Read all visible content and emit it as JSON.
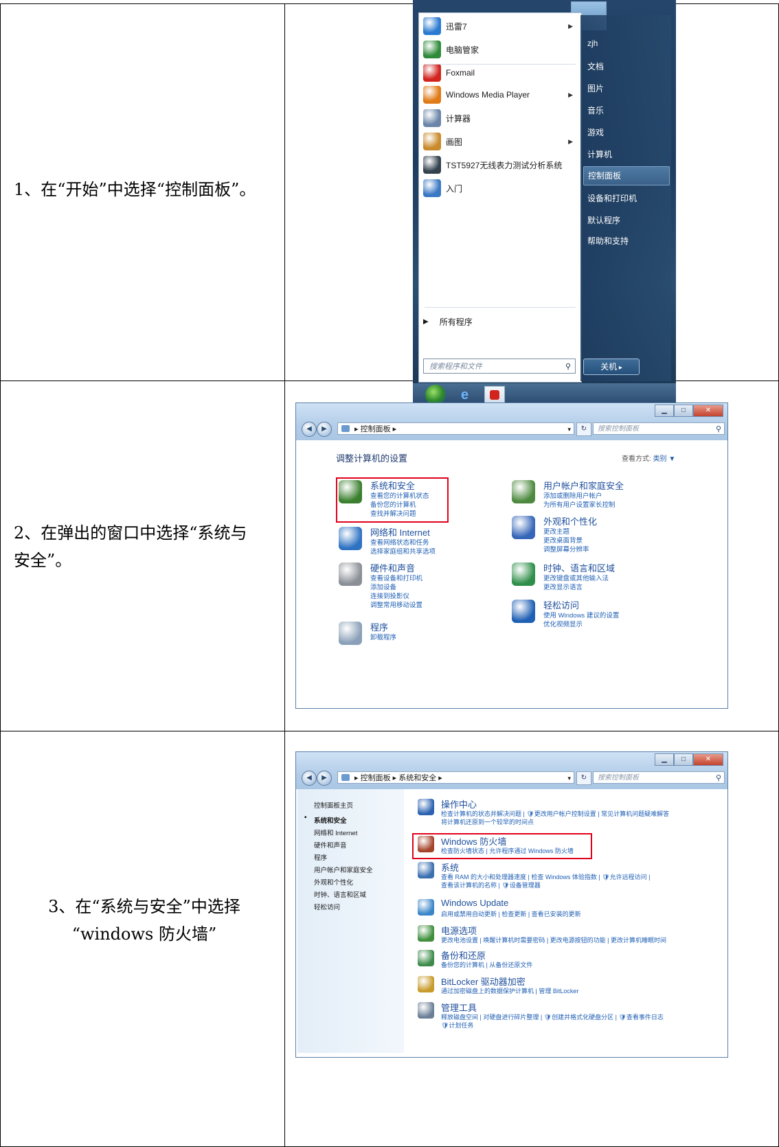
{
  "rows": [
    {
      "lines": [
        "1、在“开始”中选择“控制面板”。"
      ]
    },
    {
      "lines": [
        "2、在弹出的窗口中选择“系统与",
        "安全”。"
      ]
    },
    {
      "lines": [
        "3、在“系统与安全”中选择",
        "“windows 防火墙”"
      ]
    }
  ],
  "start_menu": {
    "programs": [
      {
        "label": "迅雷7",
        "icon": "thunder-icon",
        "color": "#2a7ad1",
        "arrow": true
      },
      {
        "label": "电脑管家",
        "icon": "pc-manager-icon",
        "color": "#2f8b3a",
        "arrow": false
      },
      {
        "label": "Foxmail",
        "icon": "foxmail-icon",
        "color": "#d2231d",
        "arrow": false
      },
      {
        "label": "Windows Media Player",
        "icon": "media-player-icon",
        "color": "#e07a16",
        "arrow": true
      },
      {
        "label": "计算器",
        "icon": "calculator-icon",
        "color": "#6b86a8",
        "arrow": false
      },
      {
        "label": "画图",
        "icon": "paint-icon",
        "color": "#c98a2b",
        "arrow": true
      },
      {
        "label": "TST5927无线表力测试分析系统",
        "icon": "tst-icon",
        "color": "#34424f",
        "arrow": false
      },
      {
        "label": "入门",
        "icon": "getting-started-icon",
        "color": "#3b78c4",
        "arrow": false
      }
    ],
    "all_programs": "所有程序",
    "search_placeholder": "搜索程序和文件",
    "right_items": [
      "zjh",
      "文档",
      "图片",
      "音乐",
      "游戏",
      "计算机",
      "控制面板",
      "设备和打印机",
      "默认程序",
      "帮助和支持"
    ],
    "selected_right": "控制面板",
    "shutdown": "关机"
  },
  "window1": {
    "address": [
      "控制面板"
    ],
    "search_placeholder": "搜索控制面板",
    "heading": "调整计算机的设置",
    "view_by_label": "查看方式:",
    "view_by_value": "类别 ▼",
    "categories_left": [
      {
        "title": "系统和安全",
        "icon": "system-security-icon",
        "color": "#3a7f2e",
        "links": [
          "查看您的计算机状态",
          "备份您的计算机",
          "查找并解决问题"
        ]
      },
      {
        "title": "网络和 Internet",
        "icon": "network-icon",
        "color": "#2e72c2",
        "links": [
          "查看网络状态和任务",
          "选择家庭组和共享选项"
        ]
      },
      {
        "title": "硬件和声音",
        "icon": "hardware-sound-icon",
        "color": "#8a8f96",
        "links": [
          "查看设备和打印机",
          "添加设备",
          "连接到投影仪",
          "调整常用移动设置"
        ]
      },
      {
        "title": "程序",
        "icon": "programs-icon",
        "color": "#8aa0b8",
        "links": [
          "卸载程序"
        ]
      }
    ],
    "categories_right": [
      {
        "title": "用户帐户和家庭安全",
        "icon": "user-accounts-icon",
        "color": "#4d8a3f",
        "links": [
          "添加或删除用户帐户",
          "为所有用户设置家长控制"
        ]
      },
      {
        "title": "外观和个性化",
        "icon": "appearance-icon",
        "color": "#3666b8",
        "links": [
          "更改主题",
          "更改桌面背景",
          "调整屏幕分辨率"
        ]
      },
      {
        "title": "时钟、语言和区域",
        "icon": "clock-language-icon",
        "color": "#2f8f4a",
        "links": [
          "更改键盘或其他输入法",
          "更改显示语言"
        ]
      },
      {
        "title": "轻松访问",
        "icon": "ease-of-access-icon",
        "color": "#1f5fb4",
        "links": [
          "使用 Windows 建议的设置",
          "优化视频显示"
        ]
      }
    ]
  },
  "window2": {
    "address": [
      "控制面板",
      "系统和安全"
    ],
    "search_placeholder": "搜索控制面板",
    "sidebar": [
      "控制面板主页",
      "系统和安全",
      "网络和 Internet",
      "硬件和声音",
      "程序",
      "用户帐户和家庭安全",
      "外观和个性化",
      "时钟、语言和区域",
      "轻松访问"
    ],
    "sidebar_current": "系统和安全",
    "sections": [
      {
        "title": "操作中心",
        "icon": "action-center-icon",
        "color": "#2c63b0",
        "links": [
          "检查计算机的状态并解决问题 | 🛡更改用户帐户控制设置 | 常见计算机问题疑难解答",
          "将计算机还原到一个较早的时间点"
        ]
      },
      {
        "title": "Windows 防火墙",
        "icon": "firewall-icon",
        "color": "#a4432a",
        "links": [
          "检查防火墙状态 | 允许程序通过 Windows 防火墙"
        ]
      },
      {
        "title": "系统",
        "icon": "system-icon",
        "color": "#3a6fb0",
        "links": [
          "查看 RAM 的大小和处理器速度 | 检查 Windows 体验指数 | 🛡允许远程访问 |",
          "查看该计算机的名称 | 🛡设备管理器"
        ]
      },
      {
        "title": "Windows Update",
        "icon": "windows-update-icon",
        "color": "#3a86c8",
        "links": [
          "启用或禁用自动更新 | 检查更新 | 查看已安装的更新"
        ]
      },
      {
        "title": "电源选项",
        "icon": "power-options-icon",
        "color": "#3f8f3c",
        "links": [
          "更改电池设置 | 唤醒计算机时需要密码 | 更改电源按钮的功能 | 更改计算机睡眠时间"
        ]
      },
      {
        "title": "备份和还原",
        "icon": "backup-restore-icon",
        "color": "#3d8c4a",
        "links": [
          "备份您的计算机 | 从备份还原文件"
        ]
      },
      {
        "title": "BitLocker 驱动器加密",
        "icon": "bitlocker-icon",
        "color": "#c79a2a",
        "links": [
          "通过加密磁盘上的数据保护计算机 | 管理 BitLocker"
        ]
      },
      {
        "title": "管理工具",
        "icon": "admin-tools-icon",
        "color": "#6b7f96",
        "links": [
          "释放磁盘空间 | 对硬盘进行碎片整理 | 🛡创建并格式化硬盘分区 | 🛡查看事件日志",
          "🛡计划任务"
        ]
      }
    ]
  }
}
